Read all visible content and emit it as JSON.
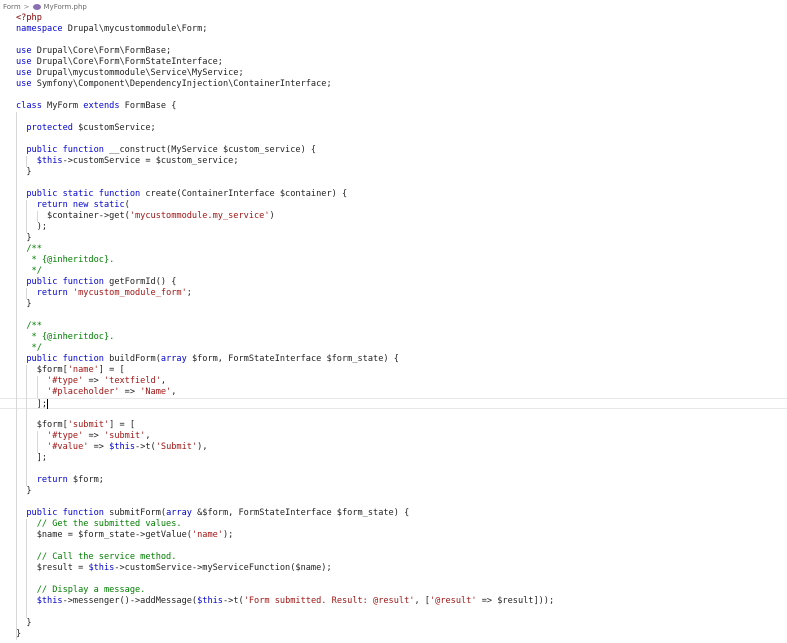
{
  "breadcrumb": {
    "folder": "Form",
    "separator": ">",
    "file_icon": "php-file-icon",
    "file": "MyForm.php"
  },
  "code_lines": [
    [
      {
        "t": "<?php",
        "c": "tag"
      }
    ],
    [
      {
        "t": "namespace",
        "c": "kw"
      },
      {
        "t": " Drupal\\mycustommodule\\Form;",
        "c": "pl"
      }
    ],
    [],
    [
      {
        "t": "use",
        "c": "kw"
      },
      {
        "t": " Drupal\\Core\\Form\\FormBase;",
        "c": "pl"
      }
    ],
    [
      {
        "t": "use",
        "c": "kw"
      },
      {
        "t": " Drupal\\Core\\Form\\FormStateInterface;",
        "c": "pl"
      }
    ],
    [
      {
        "t": "use",
        "c": "kw"
      },
      {
        "t": " Drupal\\mycustommodule\\Service\\MyService;",
        "c": "pl"
      }
    ],
    [
      {
        "t": "use",
        "c": "kw"
      },
      {
        "t": " Symfony\\Component\\DependencyInjection\\ContainerInterface;",
        "c": "pl"
      }
    ],
    [],
    [
      {
        "t": "class",
        "c": "kw"
      },
      {
        "t": " MyForm ",
        "c": "pl"
      },
      {
        "t": "extends",
        "c": "kw"
      },
      {
        "t": " FormBase {",
        "c": "pl"
      }
    ],
    [],
    [
      {
        "t": "  protected",
        "c": "kw"
      },
      {
        "t": " $customService;",
        "c": "pl"
      }
    ],
    [],
    [
      {
        "t": "  public function",
        "c": "kw"
      },
      {
        "t": " __construct(MyService $custom_service) {",
        "c": "pl"
      }
    ],
    [
      {
        "t": "    $this",
        "c": "this"
      },
      {
        "t": "->customService = $custom_service;",
        "c": "pl"
      }
    ],
    [
      {
        "t": "  }",
        "c": "pl"
      }
    ],
    [],
    [
      {
        "t": "  public static function",
        "c": "kw"
      },
      {
        "t": " create(ContainerInterface $container) {",
        "c": "pl"
      }
    ],
    [
      {
        "t": "    return new static",
        "c": "kw"
      },
      {
        "t": "(",
        "c": "pl"
      }
    ],
    [
      {
        "t": "      $container->get(",
        "c": "pl"
      },
      {
        "t": "'mycustommodule.my_service'",
        "c": "str"
      },
      {
        "t": ")",
        "c": "pl"
      }
    ],
    [
      {
        "t": "    );",
        "c": "pl"
      }
    ],
    [
      {
        "t": "  }",
        "c": "pl"
      }
    ],
    [
      {
        "t": "  /**",
        "c": "cm"
      }
    ],
    [
      {
        "t": "   * {@inheritdoc}.",
        "c": "cm"
      }
    ],
    [
      {
        "t": "   */",
        "c": "cm"
      }
    ],
    [
      {
        "t": "  public function",
        "c": "kw"
      },
      {
        "t": " getFormId() {",
        "c": "pl"
      }
    ],
    [
      {
        "t": "    return",
        "c": "kw"
      },
      {
        "t": " ",
        "c": "pl"
      },
      {
        "t": "'mycustom_module_form'",
        "c": "str"
      },
      {
        "t": ";",
        "c": "pl"
      }
    ],
    [
      {
        "t": "  }",
        "c": "pl"
      }
    ],
    [],
    [
      {
        "t": "  /**",
        "c": "cm"
      }
    ],
    [
      {
        "t": "   * {@inheritdoc}.",
        "c": "cm"
      }
    ],
    [
      {
        "t": "   */",
        "c": "cm"
      }
    ],
    [
      {
        "t": "  public function",
        "c": "kw"
      },
      {
        "t": " buildForm(",
        "c": "pl"
      },
      {
        "t": "array",
        "c": "kw"
      },
      {
        "t": " $form, FormStateInterface $form_state) {",
        "c": "pl"
      }
    ],
    [
      {
        "t": "    $form[",
        "c": "pl"
      },
      {
        "t": "'name'",
        "c": "str"
      },
      {
        "t": "] = [",
        "c": "pl"
      }
    ],
    [
      {
        "t": "      ",
        "c": "pl"
      },
      {
        "t": "'#type'",
        "c": "str"
      },
      {
        "t": " => ",
        "c": "pl"
      },
      {
        "t": "'textfield'",
        "c": "str"
      },
      {
        "t": ",",
        "c": "pl"
      }
    ],
    [
      {
        "t": "      ",
        "c": "pl"
      },
      {
        "t": "'#placeholder'",
        "c": "str"
      },
      {
        "t": " => ",
        "c": "pl"
      },
      {
        "t": "'Name'",
        "c": "str"
      },
      {
        "t": ",",
        "c": "pl"
      }
    ],
    [
      {
        "t": "    ];",
        "c": "pl"
      }
    ],
    [],
    [
      {
        "t": "    $form[",
        "c": "pl"
      },
      {
        "t": "'submit'",
        "c": "str"
      },
      {
        "t": "] = [",
        "c": "pl"
      }
    ],
    [
      {
        "t": "      ",
        "c": "pl"
      },
      {
        "t": "'#type'",
        "c": "str"
      },
      {
        "t": " => ",
        "c": "pl"
      },
      {
        "t": "'submit'",
        "c": "str"
      },
      {
        "t": ",",
        "c": "pl"
      }
    ],
    [
      {
        "t": "      ",
        "c": "pl"
      },
      {
        "t": "'#value'",
        "c": "str"
      },
      {
        "t": " => ",
        "c": "pl"
      },
      {
        "t": "$this",
        "c": "this"
      },
      {
        "t": "->t(",
        "c": "pl"
      },
      {
        "t": "'Submit'",
        "c": "str"
      },
      {
        "t": "),",
        "c": "pl"
      }
    ],
    [
      {
        "t": "    ];",
        "c": "pl"
      }
    ],
    [],
    [
      {
        "t": "    return",
        "c": "kw"
      },
      {
        "t": " $form;",
        "c": "pl"
      }
    ],
    [
      {
        "t": "  }",
        "c": "pl"
      }
    ],
    [],
    [
      {
        "t": "  public function",
        "c": "kw"
      },
      {
        "t": " submitForm(",
        "c": "pl"
      },
      {
        "t": "array",
        "c": "kw"
      },
      {
        "t": " &$form, FormStateInterface $form_state) {",
        "c": "pl"
      }
    ],
    [
      {
        "t": "    // Get the submitted values.",
        "c": "cm"
      }
    ],
    [
      {
        "t": "    $name = $form_state->getValue(",
        "c": "pl"
      },
      {
        "t": "'name'",
        "c": "str"
      },
      {
        "t": ");",
        "c": "pl"
      }
    ],
    [],
    [
      {
        "t": "    // Call the service method.",
        "c": "cm"
      }
    ],
    [
      {
        "t": "    $result = ",
        "c": "pl"
      },
      {
        "t": "$this",
        "c": "this"
      },
      {
        "t": "->customService->myServiceFunction($name);",
        "c": "pl"
      }
    ],
    [],
    [
      {
        "t": "    // Display a message.",
        "c": "cm"
      }
    ],
    [
      {
        "t": "    $this",
        "c": "this"
      },
      {
        "t": "->messenger()->addMessage(",
        "c": "pl"
      },
      {
        "t": "$this",
        "c": "this"
      },
      {
        "t": "->t(",
        "c": "pl"
      },
      {
        "t": "'Form submitted. Result: @result'",
        "c": "str"
      },
      {
        "t": ", [",
        "c": "pl"
      },
      {
        "t": "'@result'",
        "c": "str"
      },
      {
        "t": " => $result]));",
        "c": "pl"
      }
    ],
    [],
    [
      {
        "t": "  }",
        "c": "pl"
      }
    ],
    [
      {
        "t": "}",
        "c": "pl"
      }
    ]
  ]
}
